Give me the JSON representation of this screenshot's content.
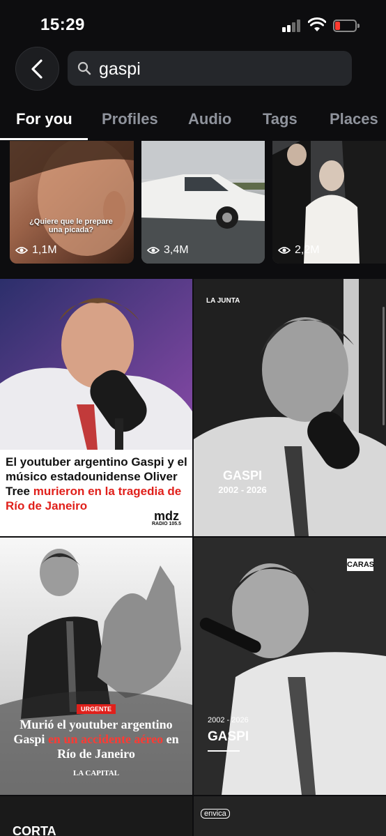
{
  "status_bar": {
    "time": "15:29"
  },
  "search": {
    "query": "gaspi"
  },
  "tabs": [
    {
      "label": "For you",
      "active": true
    },
    {
      "label": "Profiles",
      "active": false
    },
    {
      "label": "Audio",
      "active": false
    },
    {
      "label": "Tags",
      "active": false
    },
    {
      "label": "Places",
      "active": false
    }
  ],
  "reels": [
    {
      "views": "1,1M",
      "caption": "¿Quiere que le prepare una picada?"
    },
    {
      "views": "3,4M"
    },
    {
      "views": "2,2M"
    }
  ],
  "posts": [
    {
      "headline_plain": "El youtuber argentino Gaspi y el músico estadounidense Oliver Tree ",
      "headline_red": "murieron en la tragedia de Río de Janeiro",
      "brand": "mdz",
      "brand_sub": "RADIO 105.5"
    },
    {
      "brand": "LA JUNTA",
      "title": "GASPI",
      "years": "2002 - 2026"
    },
    {
      "badge": "URGENTE",
      "headline_plain_1": "Murió el youtuber argentino Gaspi ",
      "headline_red": "en un accidente aéreo",
      "headline_plain_2": " en Río de Janeiro",
      "brand": "LA CAPITAL"
    },
    {
      "brand": "CARAS",
      "years": "2002 - 2026",
      "title": "GASPI"
    },
    {
      "brand": "CORTA"
    },
    {
      "brand": "envica"
    }
  ],
  "colors": {
    "accent_red": "#e0201b",
    "battery_red": "#ff3b30"
  }
}
